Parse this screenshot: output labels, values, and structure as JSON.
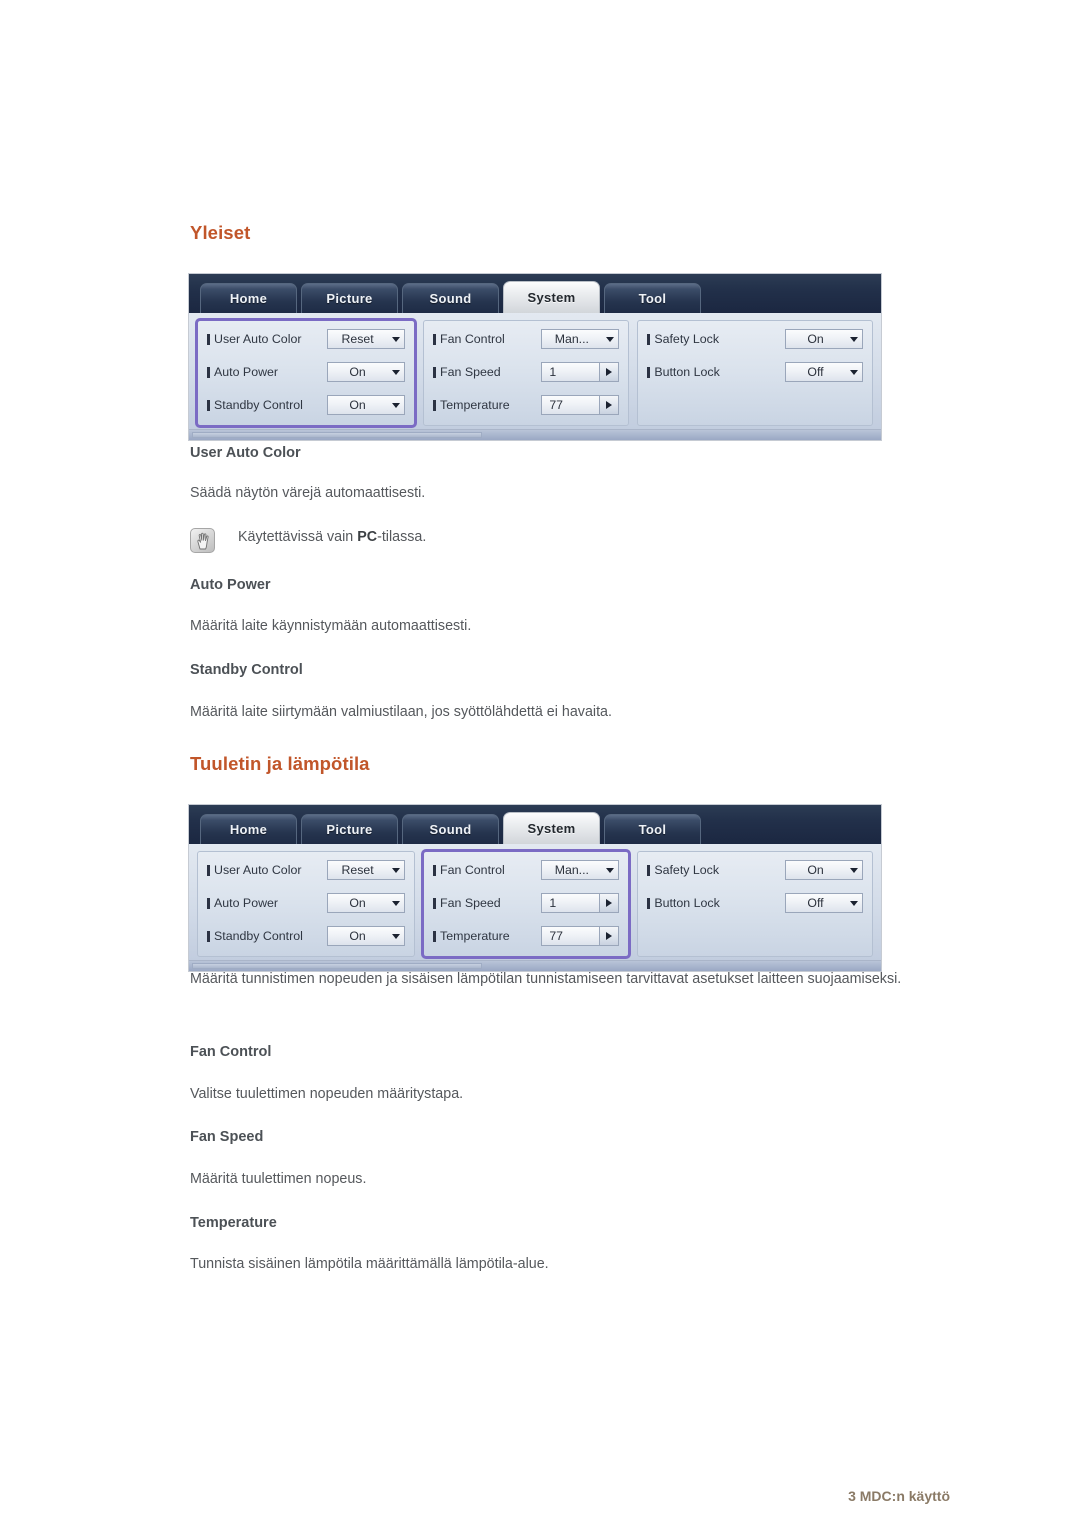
{
  "sections": [
    {
      "heading": "Yleiset",
      "subsections": [
        {
          "title": "User Auto Color",
          "body": "Säädä näytön värejä automaattisesti."
        },
        {
          "title": "Auto Power",
          "body": "Määritä laite käynnistymään automaattisesti."
        },
        {
          "title": "Standby Control",
          "body": "Määritä laite siirtymään valmiustilaan, jos syöttölähdettä ei havaita."
        }
      ],
      "note": {
        "icon": "note-hand-icon",
        "text_before": "Käytettävissä vain ",
        "text_bold": "PC",
        "text_after": "-tilassa."
      }
    },
    {
      "heading": "Tuuletin ja lämpötila",
      "intro": "Määritä tunnistimen nopeuden ja sisäisen lämpötilan tunnistamiseen tarvittavat asetukset laitteen suojaamiseksi.",
      "subsections": [
        {
          "title": "Fan Control",
          "body": "Valitse tuulettimen nopeuden määritystapa."
        },
        {
          "title": "Fan Speed",
          "body": "Määritä tuulettimen nopeus."
        },
        {
          "title": "Temperature",
          "body": "Tunnista sisäinen lämpötila määrittämällä lämpötila-alue."
        }
      ]
    }
  ],
  "mdc": {
    "tabs": [
      {
        "label": "Home",
        "active": false
      },
      {
        "label": "Picture",
        "active": false
      },
      {
        "label": "Sound",
        "active": false
      },
      {
        "label": "System",
        "active": true
      },
      {
        "label": "Tool",
        "active": false
      }
    ],
    "group1": {
      "rows": [
        {
          "label": "User Auto Color",
          "value": "Reset",
          "control": "dropdown"
        },
        {
          "label": "Auto Power",
          "value": "On",
          "control": "dropdown"
        },
        {
          "label": "Standby Control",
          "value": "On",
          "control": "dropdown"
        }
      ]
    },
    "group2": {
      "rows": [
        {
          "label": "Fan Control",
          "value": "Man...",
          "control": "dropdown"
        },
        {
          "label": "Fan Speed",
          "value": "1",
          "control": "spinner"
        },
        {
          "label": "Temperature",
          "value": "77",
          "control": "spinner"
        }
      ]
    },
    "group3": {
      "rows": [
        {
          "label": "Safety Lock",
          "value": "On",
          "control": "dropdown"
        },
        {
          "label": "Button Lock",
          "value": "Off",
          "control": "dropdown"
        }
      ]
    }
  },
  "colors": {
    "heading": "#c1562a",
    "body_text": "#55585c",
    "sub_heading": "#4c5156",
    "highlight": "#7b6bc4",
    "footer": "#8a7a66"
  },
  "footer": {
    "text": "3 MDC:n käyttö"
  }
}
